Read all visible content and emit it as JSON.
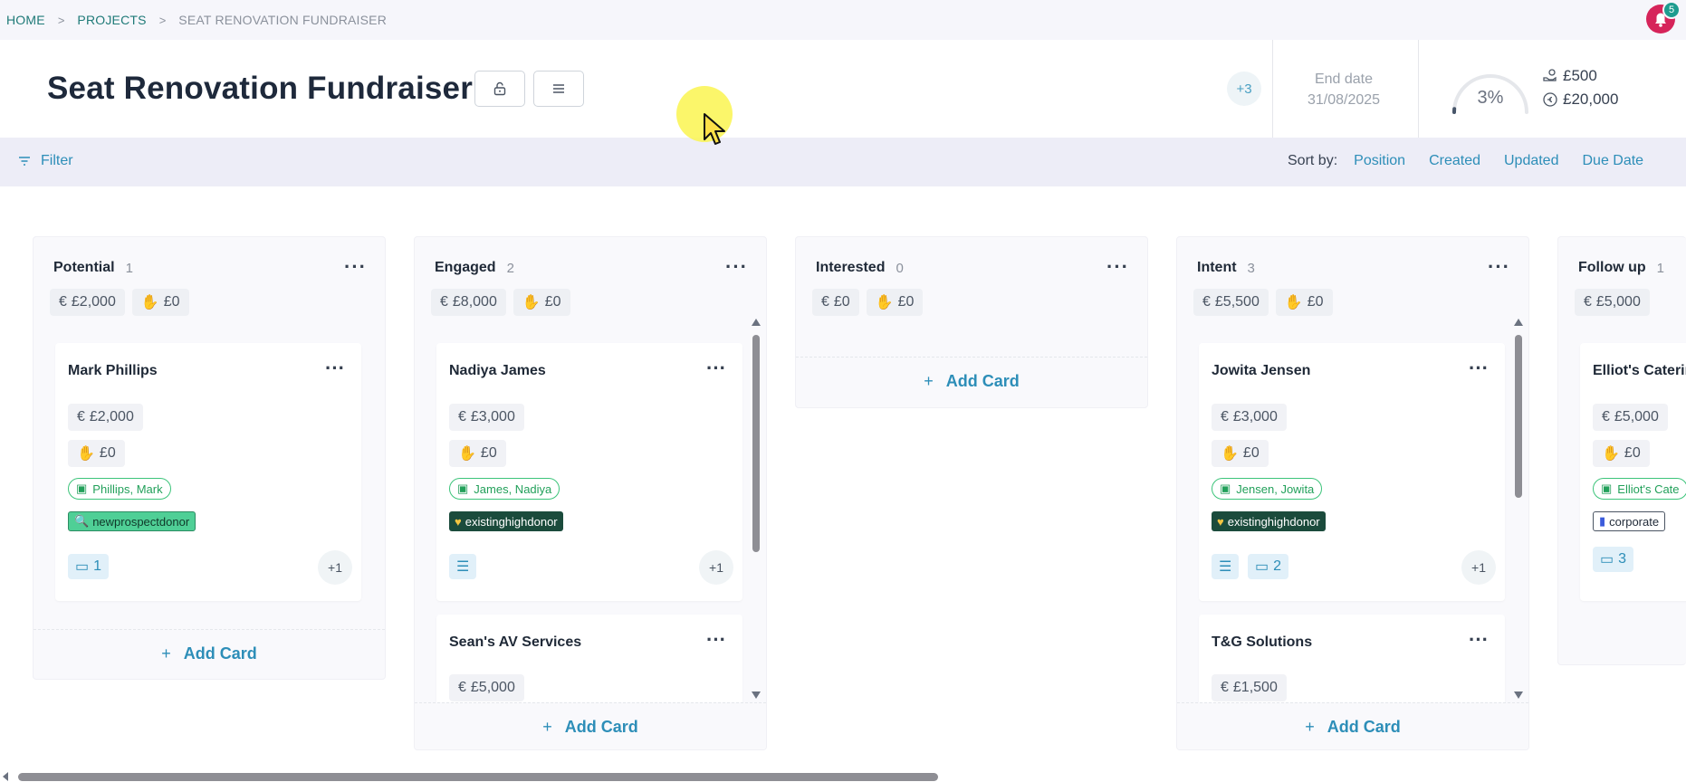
{
  "breadcrumb": {
    "home": "HOME",
    "projects": "PROJECTS",
    "current": "SEAT RENOVATION FUNDRAISER"
  },
  "notifications": {
    "count": "5"
  },
  "header": {
    "title": "Seat Renovation Fundraiser",
    "members_more": "+3",
    "end_date_label": "End date",
    "end_date_value": "31/08/2025",
    "progress_text": "3%",
    "progress_fraction": 0.03,
    "raised": "£500",
    "target": "£20,000"
  },
  "filterbar": {
    "filter_label": "Filter",
    "sort_label": "Sort by:",
    "sort_options": [
      "Position",
      "Created",
      "Updated",
      "Due Date"
    ]
  },
  "columns": [
    {
      "title": "Potential",
      "count": "1",
      "pledged": "£2,000",
      "received": "£0",
      "add_card": "Add Card",
      "cards": [
        {
          "name": "Mark Phillips",
          "pledged": "£2,000",
          "received": "£0",
          "contact": "Phillips, Mark",
          "label": "newprospectdonor",
          "comments": "1",
          "more": "+1"
        }
      ]
    },
    {
      "title": "Engaged",
      "count": "2",
      "pledged": "£8,000",
      "received": "£0",
      "add_card": "Add Card",
      "cards": [
        {
          "name": "Nadiya James",
          "pledged": "£3,000",
          "received": "£0",
          "contact": "James, Nadiya",
          "label": "existinghighdonor",
          "more": "+1"
        },
        {
          "name": "Sean's AV Services",
          "pledged": "£5,000"
        }
      ]
    },
    {
      "title": "Interested",
      "count": "0",
      "pledged": "£0",
      "received": "£0",
      "add_card": "Add Card",
      "cards": []
    },
    {
      "title": "Intent",
      "count": "3",
      "pledged": "£5,500",
      "received": "£0",
      "add_card": "Add Card",
      "cards": [
        {
          "name": "Jowita Jensen",
          "pledged": "£3,000",
          "received": "£0",
          "contact": "Jensen, Jowita",
          "label": "existinghighdonor",
          "comments": "2",
          "more": "+1"
        },
        {
          "name": "T&G Solutions",
          "pledged": "£1,500"
        }
      ]
    },
    {
      "title": "Follow up",
      "count": "1",
      "pledged": "£5,000",
      "cards": [
        {
          "name": "Elliot's Caterin",
          "pledged": "£5,000",
          "received": "£0",
          "contact": "Elliot's Cate",
          "label": "corporate",
          "comments": "3"
        }
      ]
    }
  ],
  "colors": {
    "accent": "#2d8eb8",
    "teal": "#1f7a78",
    "alert": "#d6245a"
  }
}
